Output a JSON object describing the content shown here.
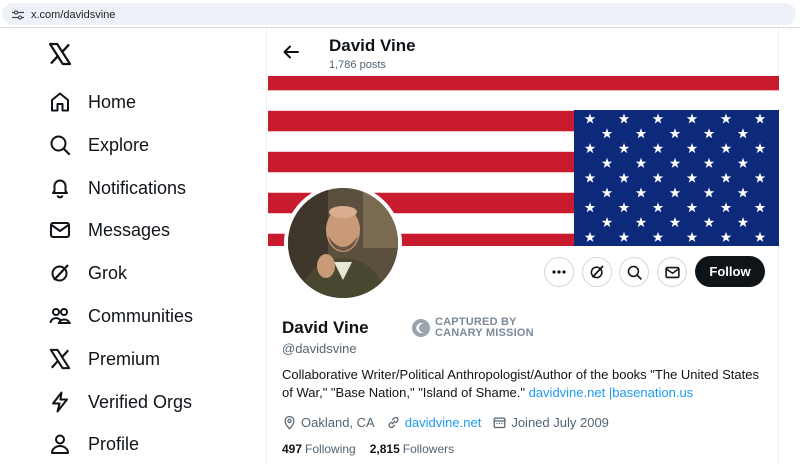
{
  "browser": {
    "url": "x.com/davidsvine"
  },
  "sidebar": {
    "items": [
      {
        "label": "Home",
        "icon": "home-icon"
      },
      {
        "label": "Explore",
        "icon": "search-icon"
      },
      {
        "label": "Notifications",
        "icon": "bell-icon"
      },
      {
        "label": "Messages",
        "icon": "envelope-icon"
      },
      {
        "label": "Grok",
        "icon": "grok-icon"
      },
      {
        "label": "Communities",
        "icon": "people-icon"
      },
      {
        "label": "Premium",
        "icon": "x-logo-icon"
      },
      {
        "label": "Verified Orgs",
        "icon": "lightning-icon"
      },
      {
        "label": "Profile",
        "icon": "person-icon"
      }
    ]
  },
  "header": {
    "name": "David Vine",
    "posts": "1,786 posts"
  },
  "profile": {
    "name": "David Vine",
    "handle": "@davidsvine",
    "badge": {
      "line1": "CAPTURED BY",
      "line2": "CANARY MISSION"
    },
    "bio": {
      "text": "Collaborative Writer/Political Anthropologist/Author of the books \"The United States of War,\" \"Base Nation,\" \"Island of Shame.\" ",
      "link1": "davidvine.net",
      "sep": " |",
      "link2": "basenation.us"
    },
    "location": "Oakland, CA",
    "website": "davidvine.net",
    "joined": "Joined July 2009",
    "following_count": "497",
    "following_label": "Following",
    "followers_count": "2,815",
    "followers_label": "Followers",
    "follow_label": "Follow"
  },
  "colors": {
    "flag_red": "#c81c2e",
    "flag_blue": "#0d2a7a",
    "link": "#1d9bf0",
    "text": "#0f1419",
    "muted": "#536471"
  }
}
